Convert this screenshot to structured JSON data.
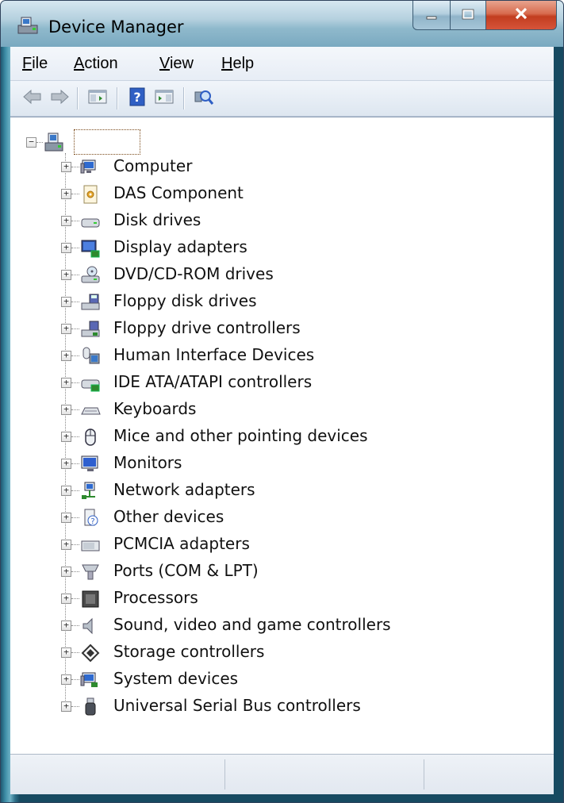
{
  "window": {
    "title": "Device Manager"
  },
  "menu": [
    {
      "label_u": "F",
      "label_rest": "ile"
    },
    {
      "label_u": "A",
      "label_rest": "ction"
    },
    {
      "label_u": "V",
      "label_rest": "iew"
    },
    {
      "label_u": "H",
      "label_rest": "elp"
    }
  ],
  "toolbar": {
    "buttons": [
      "back-arrow-icon",
      "forward-arrow-icon",
      "show-hide-console-tree-icon",
      "help-icon",
      "show-hide-action-pane-icon",
      "scan-hardware-icon"
    ]
  },
  "tree": {
    "root_label": "",
    "items": [
      {
        "label": "Computer",
        "icon": "computer-icon"
      },
      {
        "label": "DAS Component",
        "icon": "das-component-icon"
      },
      {
        "label": "Disk drives",
        "icon": "disk-drive-icon"
      },
      {
        "label": "Display adapters",
        "icon": "display-adapter-icon"
      },
      {
        "label": "DVD/CD-ROM drives",
        "icon": "dvd-drive-icon"
      },
      {
        "label": "Floppy disk drives",
        "icon": "floppy-drive-icon"
      },
      {
        "label": "Floppy drive controllers",
        "icon": "floppy-controller-icon"
      },
      {
        "label": "Human Interface Devices",
        "icon": "hid-icon"
      },
      {
        "label": "IDE ATA/ATAPI controllers",
        "icon": "ide-controller-icon"
      },
      {
        "label": "Keyboards",
        "icon": "keyboard-icon"
      },
      {
        "label": "Mice and other pointing devices",
        "icon": "mouse-icon"
      },
      {
        "label": "Monitors",
        "icon": "monitor-icon"
      },
      {
        "label": "Network adapters",
        "icon": "network-adapter-icon"
      },
      {
        "label": "Other devices",
        "icon": "unknown-device-icon"
      },
      {
        "label": "PCMCIA adapters",
        "icon": "pcmcia-icon"
      },
      {
        "label": "Ports (COM & LPT)",
        "icon": "port-icon"
      },
      {
        "label": "Processors",
        "icon": "processor-icon"
      },
      {
        "label": "Sound, video and game controllers",
        "icon": "speaker-icon"
      },
      {
        "label": "Storage controllers",
        "icon": "storage-controller-icon"
      },
      {
        "label": "System devices",
        "icon": "system-devices-icon"
      },
      {
        "label": "Universal Serial Bus controllers",
        "icon": "usb-icon"
      }
    ]
  },
  "status": {
    "panes": [
      "",
      "",
      ""
    ]
  }
}
